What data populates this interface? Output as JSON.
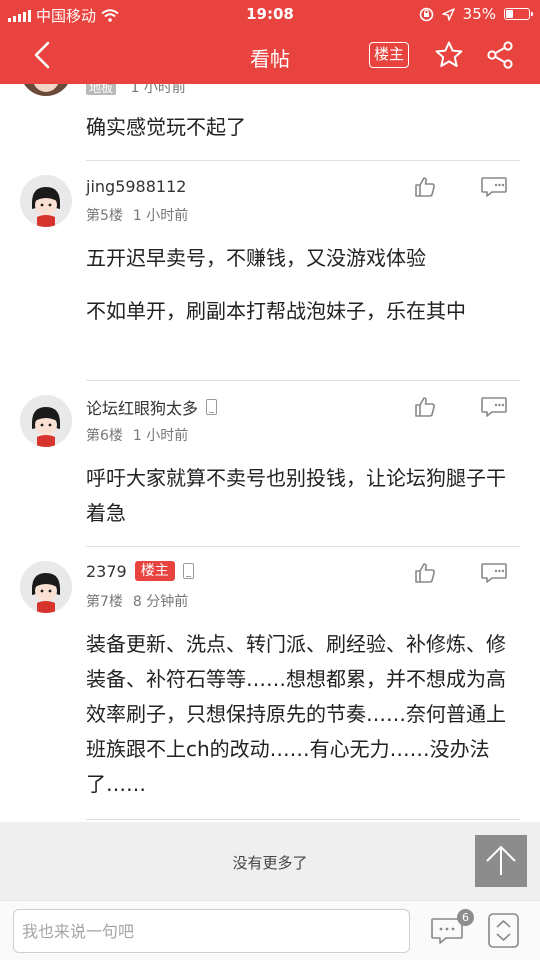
{
  "status_bar": {
    "carrier": "中国移动",
    "time": "19:08",
    "battery": "35%",
    "battery_level": 0.35
  },
  "nav": {
    "title": "看帖",
    "owner_only_label": "楼主"
  },
  "posts": [
    {
      "floor": "地板",
      "time": "1 小时前",
      "content": [
        "确实感觉玩不起了"
      ]
    },
    {
      "username": "jing5988112",
      "floor": "第5楼",
      "time": "1 小时前",
      "content": [
        "五开迟早卖号，不赚钱，又没游戏体验",
        "不如单开，刷副本打帮战泡妹子，乐在其中"
      ]
    },
    {
      "username": "论坛红眼狗太多",
      "floor": "第6楼",
      "time": "1 小时前",
      "content": [
        "呼吁大家就算不卖号也别投钱，让论坛狗腿子干着急"
      ]
    },
    {
      "username": "2379",
      "owner_tag": "楼主",
      "floor": "第7楼",
      "time": "8 分钟前",
      "content": [
        "装备更新、洗点、转门派、刷经验、补修炼、修装备、补符石等等……想想都累，并不想成为高效率刷子，只想保持原先的节奏……奈何普通上班族跟不上ch的改动……有心无力……没办法了……"
      ]
    }
  ],
  "footer": {
    "no_more": "没有更多了"
  },
  "bottom_bar": {
    "reply_placeholder": "我也来说一句吧",
    "comment_count": "6"
  },
  "colors": {
    "brand_red": "#e8433f"
  }
}
